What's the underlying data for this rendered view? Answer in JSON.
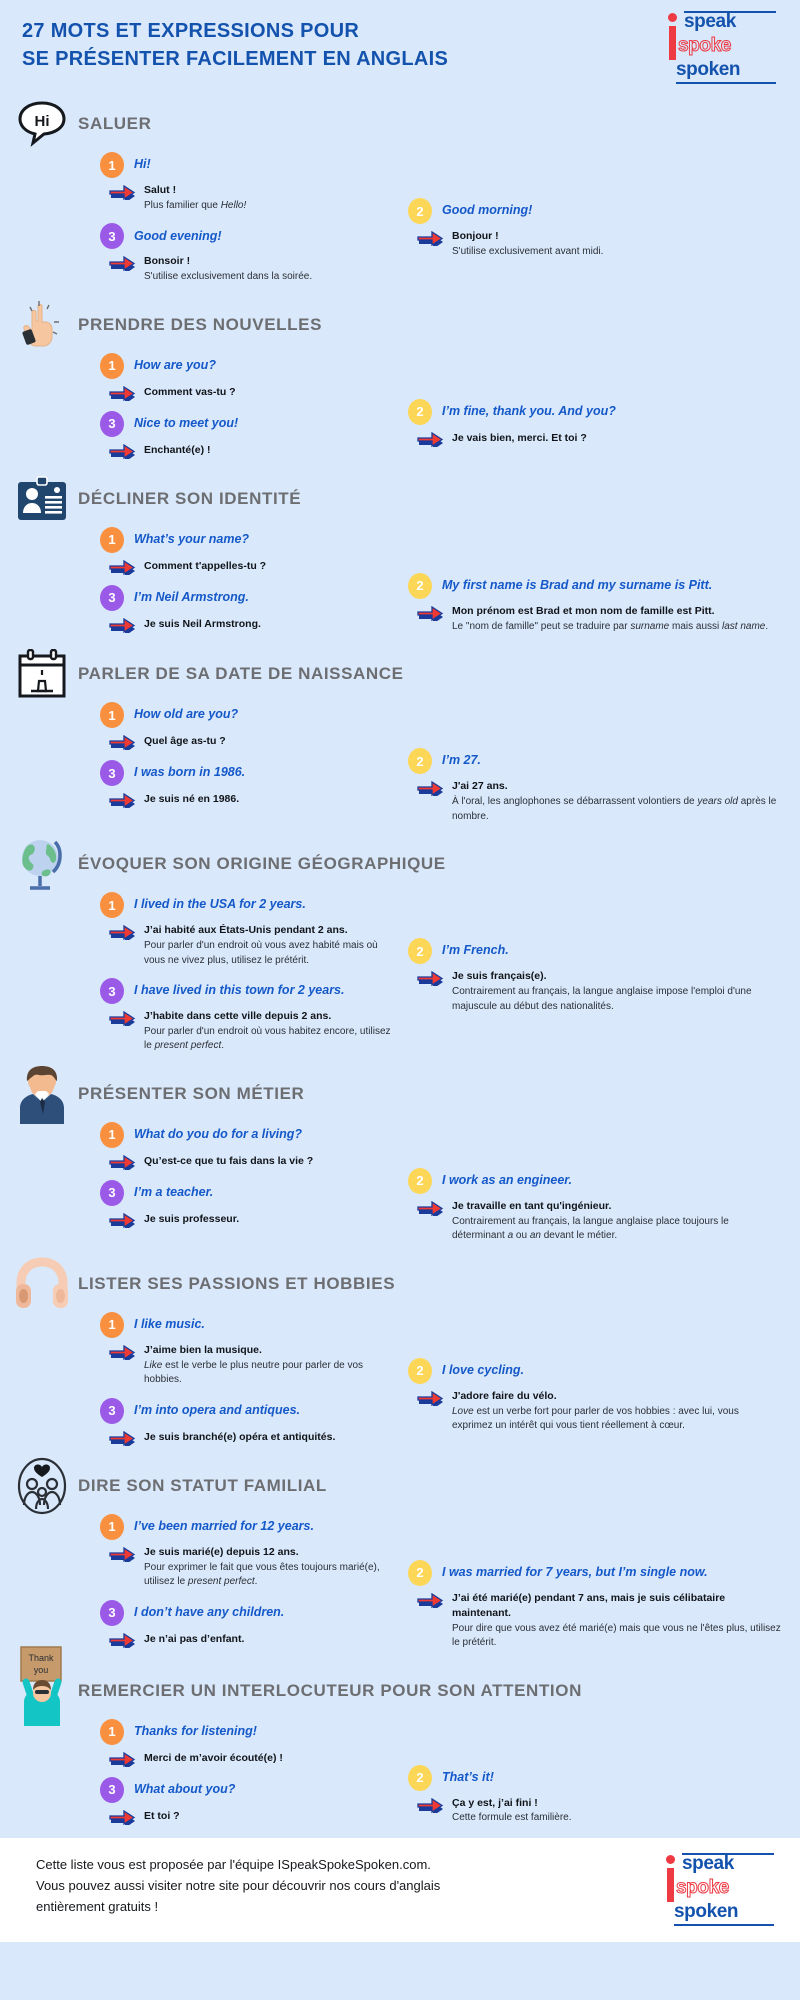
{
  "header": {
    "title_line1": "27 MOTS ET EXPRESSIONS POUR",
    "title_line2": "SE PRÉSENTER FACILEMENT EN ANGLAIS"
  },
  "logo": {
    "word1": "speak",
    "word2": "spoke",
    "word3": "spoken"
  },
  "colors": {
    "background": "#d9e8fb",
    "title_blue": "#1352ad",
    "english_blue": "#1559c9",
    "section_gray": "#6d6e71",
    "num1_orange": "#f89040",
    "num2_yellow": "#fcd757",
    "num3_purple": "#9b59e8",
    "arrow_red": "#ee3a33",
    "arrow_blue": "#1b3b9b",
    "footer_bg": "#ffffff"
  },
  "sections": [
    {
      "id": "saluer",
      "title": "SALUER",
      "icon": "speech-bubble-hi-icon",
      "left": [
        {
          "num": "1",
          "en": "Hi!",
          "fr": "Salut !",
          "note": "Plus familier que <i>Hello!</i>"
        },
        {
          "num": "3",
          "en": "Good evening!",
          "fr": "Bonsoir !",
          "note": "S'utilise exclusivement dans la soirée."
        }
      ],
      "right": [
        {
          "num": "2",
          "en": "Good morning!",
          "fr": "Bonjour !",
          "note": "S'utilise exclusivement avant midi."
        }
      ]
    },
    {
      "id": "prendre-des-nouvelles",
      "title": "PRENDRE DES NOUVELLES",
      "icon": "pointing-hand-icon",
      "left": [
        {
          "num": "1",
          "en": "How are you?",
          "fr": "Comment vas-tu ?",
          "note": ""
        },
        {
          "num": "3",
          "en": "Nice to meet you!",
          "fr": "Enchanté(e) !",
          "note": ""
        }
      ],
      "right": [
        {
          "num": "2",
          "en": "I’m fine, thank you. And you?",
          "fr": "Je vais bien, merci. Et toi ?",
          "note": ""
        }
      ]
    },
    {
      "id": "decliner-son-identite",
      "title": "DÉCLINER SON IDENTITÉ",
      "icon": "id-card-icon",
      "left": [
        {
          "num": "1",
          "en": "What’s your name?",
          "fr": "Comment t'appelles-tu ?",
          "note": ""
        },
        {
          "num": "3",
          "en": "I’m Neil Armstrong.",
          "fr": "Je suis Neil Armstrong.",
          "note": ""
        }
      ],
      "right": [
        {
          "num": "2",
          "en": "My first name is Brad and my surname is Pitt.",
          "fr": "Mon prénom est Brad et mon nom de famille est Pitt.",
          "note": "Le \"nom de famille\" peut se traduire par <i>surname</i> mais aussi <i>last name</i>."
        }
      ]
    },
    {
      "id": "parler-de-sa-date-de-naissance",
      "title": "PARLER DE SA DATE DE NAISSANCE",
      "icon": "calendar-cake-icon",
      "left": [
        {
          "num": "1",
          "en": "How old are you?",
          "fr": "Quel âge as-tu ?",
          "note": ""
        },
        {
          "num": "3",
          "en": "I was born in 1986.",
          "fr": "Je suis né en 1986.",
          "note": ""
        }
      ],
      "right": [
        {
          "num": "2",
          "en": "I’m 27.",
          "fr": "J'ai 27 ans.",
          "note": "À l'oral, les anglophones se débarrassent volontiers de <i>years old</i> après le nombre."
        }
      ]
    },
    {
      "id": "evoquer-son-origine-geographique",
      "title": "ÉVOQUER SON ORIGINE GÉOGRAPHIQUE",
      "icon": "globe-icon",
      "left": [
        {
          "num": "1",
          "en": "I lived in the USA for 2 years.",
          "fr": "J’ai habité aux États-Unis pendant 2 ans.",
          "note": "Pour parler d'un endroit où vous avez habité mais où vous ne vivez plus, utilisez le prétérit."
        },
        {
          "num": "3",
          "en": "I have lived in this town for 2 years.",
          "fr": "J’habite dans cette ville depuis 2 ans.",
          "note": "Pour parler d'un endroit où vous habitez encore, utilisez le <i>present perfect</i>."
        }
      ],
      "right": [
        {
          "num": "2",
          "en": "I’m French.",
          "fr": "Je suis français(e).",
          "note": "Contrairement au français, la langue anglaise impose l'emploi d'une majuscule au début des nationalités."
        }
      ]
    },
    {
      "id": "presenter-son-metier",
      "title": "PRÉSENTER SON MÉTIER",
      "icon": "businessman-icon",
      "left": [
        {
          "num": "1",
          "en": "What do you do for a living?",
          "fr": "Qu’est-ce que tu fais dans la vie ?",
          "note": ""
        },
        {
          "num": "3",
          "en": "I’m a teacher.",
          "fr": "Je suis professeur.",
          "note": ""
        }
      ],
      "right": [
        {
          "num": "2",
          "en": "I work as an engineer.",
          "fr": "Je travaille en tant qu'ingénieur.",
          "note": "Contrairement au français, la langue anglaise place toujours le déterminant <i>a</i> ou <i>an</i> devant le métier."
        }
      ]
    },
    {
      "id": "lister-ses-passions-et-hobbies",
      "title": "LISTER SES PASSIONS ET HOBBIES",
      "icon": "headphones-icon",
      "left": [
        {
          "num": "1",
          "en": "I like music.",
          "fr": "J’aime bien la musique.",
          "note": "<i>Like</i> est le verbe le plus neutre pour parler de vos hobbies."
        },
        {
          "num": "3",
          "en": "I’m into opera and antiques.",
          "fr": "Je suis branché(e) opéra et antiquités.",
          "note": ""
        }
      ],
      "right": [
        {
          "num": "2",
          "en": "I love cycling.",
          "fr": "J'adore faire du vélo.",
          "note": "<i>Love</i> est un verbe fort pour parler de vos hobbies : avec lui, vous exprimez un intérêt qui vous tient réellement à cœur."
        }
      ]
    },
    {
      "id": "dire-son-statut-familial",
      "title": "DIRE SON STATUT FAMILIAL",
      "icon": "family-heart-icon",
      "left": [
        {
          "num": "1",
          "en": "I’ve been married for 12 years.",
          "fr": "Je suis marié(e) depuis 12 ans.",
          "note": "Pour exprimer le fait que vous êtes toujours marié(e), utilisez le <i>present perfect</i>."
        },
        {
          "num": "3",
          "en": "I don’t have any children.",
          "fr": "Je n’ai pas d’enfant.",
          "note": ""
        }
      ],
      "right": [
        {
          "num": "2",
          "en": "I was married for 7 years, but I’m single now.",
          "fr": "J’ai été marié(e) pendant 7 ans, mais je suis célibataire maintenant.",
          "note": "Pour dire que vous avez été marié(e) mais que vous ne l'êtes plus, utilisez le prétérit."
        }
      ]
    },
    {
      "id": "remercier-un-interlocuteur",
      "title": "REMERCIER UN INTERLOCUTEUR POUR SON ATTENTION",
      "icon": "thank-you-sign-icon",
      "left": [
        {
          "num": "1",
          "en": "Thanks for listening!",
          "fr": "Merci de m’avoir écouté(e) !",
          "note": ""
        },
        {
          "num": "3",
          "en": "What about you?",
          "fr": "Et toi ?",
          "note": ""
        }
      ],
      "right": [
        {
          "num": "2",
          "en": "That’s it!",
          "fr": "Ça y est, j’ai fini !",
          "note": "Cette formule est familière."
        }
      ]
    }
  ],
  "footer": {
    "line1": "Cette liste vous est proposée par l'équipe ISpeakSpokeSpoken.com.",
    "line2": "Vous pouvez aussi visiter notre site pour découvrir nos cours d'anglais",
    "line3": "entièrement gratuits !"
  }
}
